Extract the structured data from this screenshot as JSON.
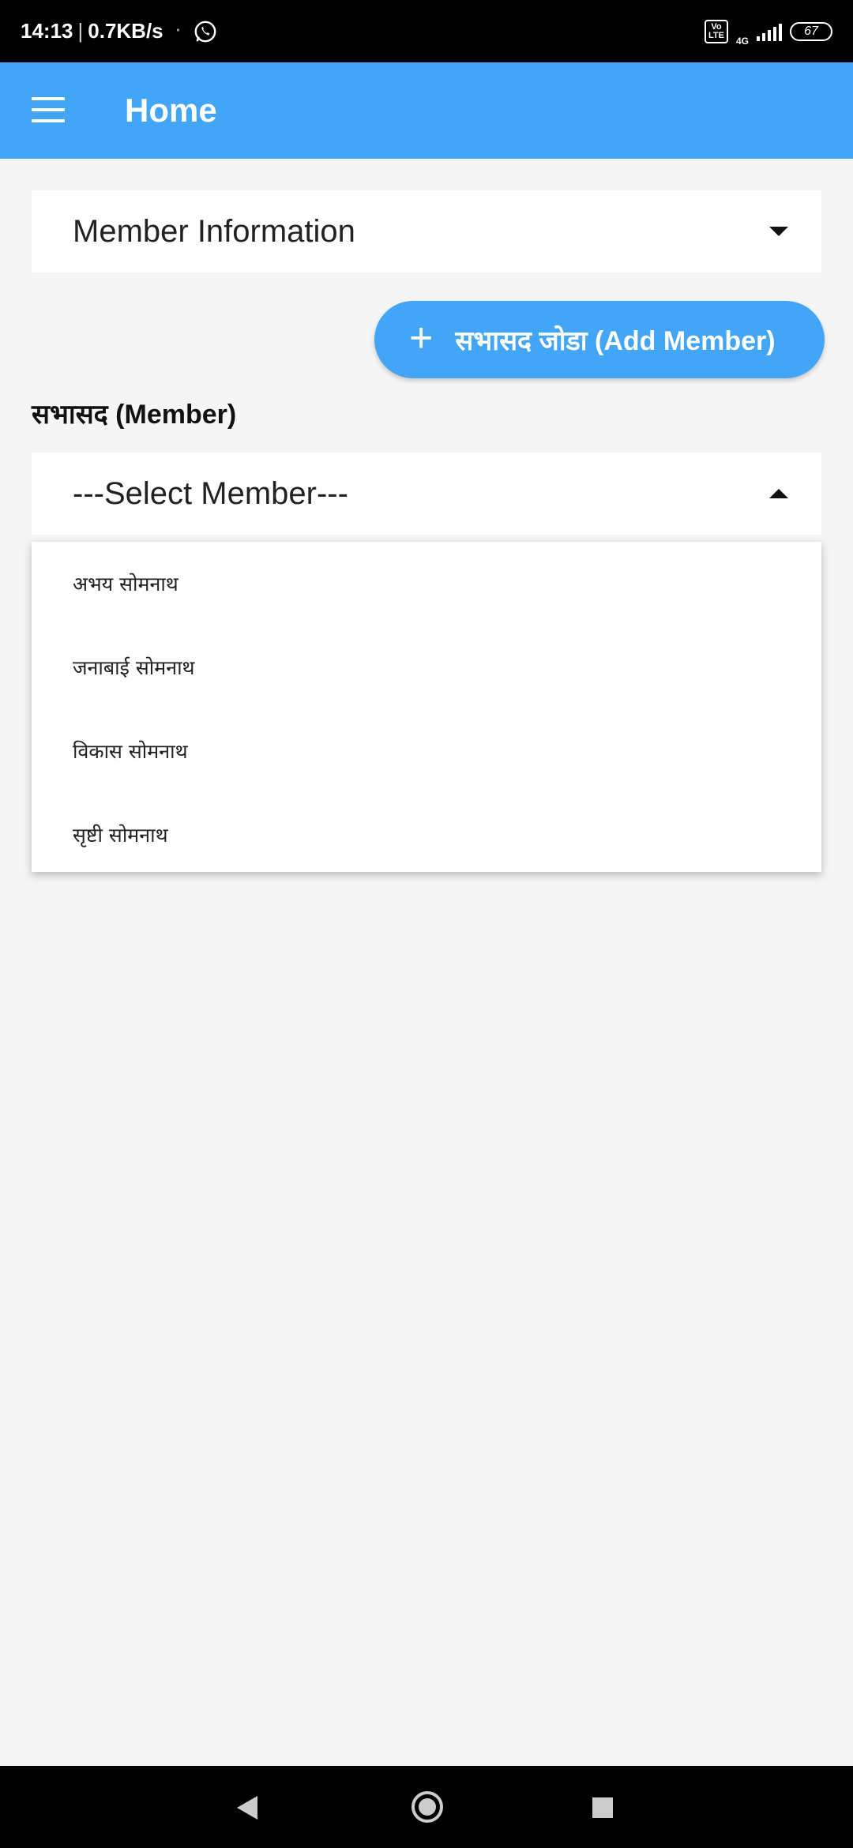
{
  "status_bar": {
    "time": "14:13",
    "speed": "0.7KB/s",
    "volte": "Vo LTE",
    "network": "4G",
    "battery": "67"
  },
  "app_bar": {
    "title": "Home"
  },
  "member_info_select": {
    "value": "Member Information"
  },
  "add_member_button": {
    "icon": "+",
    "label": "सभासद जोडा (Add Member)"
  },
  "member_section": {
    "label": "सभासद (Member)"
  },
  "member_select": {
    "value": "---Select Member---",
    "options": [
      "अभय सोमनाथ",
      "जनाबाई सोमनाथ",
      "विकास सोमनाथ",
      "सृष्टी सोमनाथ"
    ]
  },
  "colors": {
    "primary": "#42a5f5",
    "background": "#f5f5f5"
  }
}
